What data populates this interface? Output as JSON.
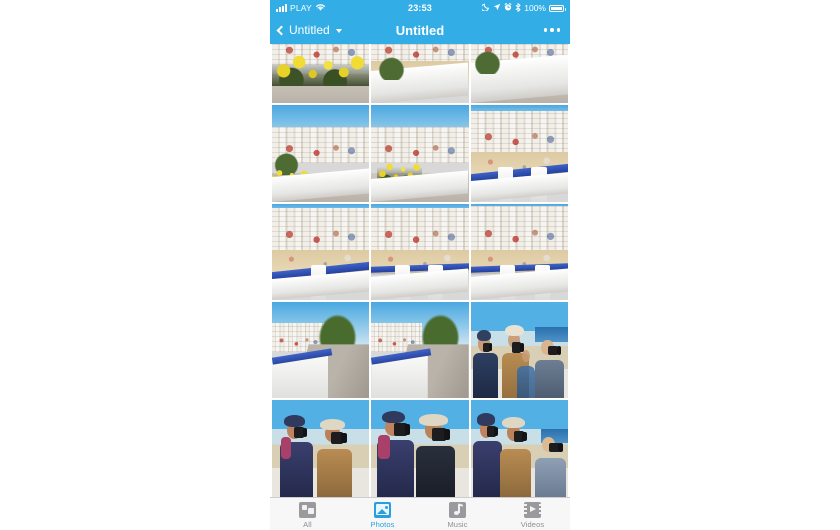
{
  "status_bar": {
    "carrier": "PLAY",
    "time": "23:53",
    "battery_percent": "100%",
    "icons": [
      "signal-bars-icon",
      "wifi-icon",
      "moon-icon",
      "location-arrow-icon",
      "alarm-clock-icon",
      "bluetooth-icon",
      "battery-icon"
    ]
  },
  "nav_bar": {
    "back_label": "Untitled",
    "title": "Untitled",
    "more_label": "•••",
    "accent_color": "#32ade6"
  },
  "tab_bar": {
    "items": [
      {
        "label": "All",
        "icon": "all-icon",
        "active": false
      },
      {
        "label": "Photos",
        "icon": "photos-icon",
        "active": true
      },
      {
        "label": "Music",
        "icon": "music-icon",
        "active": false
      },
      {
        "label": "Videos",
        "icon": "videos-icon",
        "active": false
      }
    ],
    "active_color": "#2a9fe0",
    "inactive_color": "#8e8e93"
  },
  "gallery": {
    "columns": 3,
    "photos": [
      {
        "caption": "Yellow wildflowers above the town"
      },
      {
        "caption": "White town rooftops behind a wall"
      },
      {
        "caption": "Curving seafront wall and shrubs"
      },
      {
        "caption": "Hillside town with flowering bush"
      },
      {
        "caption": "Whitewashed town and yellow broom"
      },
      {
        "caption": "Beach and blue railing overlook"
      },
      {
        "caption": "Blue railing above the sandy beach"
      },
      {
        "caption": "Beach viewpoint with white posts"
      },
      {
        "caption": "Town, beach and blue balustrade"
      },
      {
        "caption": "Promenade with pine tree"
      },
      {
        "caption": "Promenade path along the cliff"
      },
      {
        "caption": "Three photographers on the promenade"
      },
      {
        "caption": "Two photographers shooting"
      },
      {
        "caption": "Woman and man with cameras"
      },
      {
        "caption": "Photographers framing a shot"
      }
    ]
  }
}
